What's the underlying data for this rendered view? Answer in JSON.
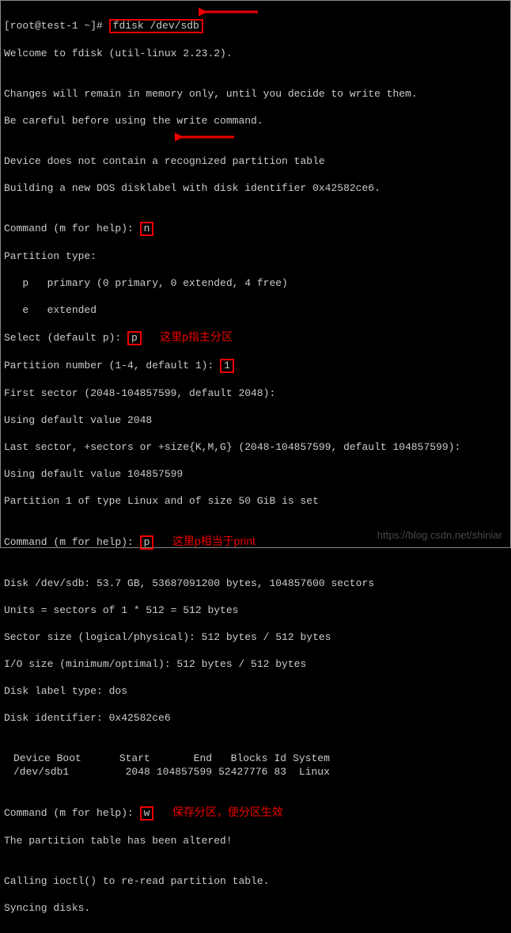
{
  "prompt": {
    "user_host": "[root@test-1 ~]#",
    "command": "fdisk /dev/sdb"
  },
  "lines": {
    "welcome": "Welcome to fdisk (util-linux 2.23.2).",
    "blank": "",
    "changes": "Changes will remain in memory only, until you decide to write them.",
    "careful": "Be careful before using the write command.",
    "noTable": "Device does not contain a recognized partition table",
    "building": "Building a new DOS disklabel with disk identifier 0x42582ce6.",
    "cmdPrompt": "Command (m for help):",
    "n_input": "n",
    "partType": "Partition type:",
    "pPrimary": "   p   primary (0 primary, 0 extended, 4 free)",
    "eExtended": "   e   extended",
    "selectDefault": "Select (default p):",
    "p_input": "p",
    "anno_pPrimary": "这里p指主分区",
    "partNum": "Partition number (1-4, default 1):",
    "one_input": "1",
    "firstSector": "First sector (2048-104857599, default 2048):",
    "usingDefault1": "Using default value 2048",
    "lastSector": "Last sector, +sectors or +size{K,M,G} (2048-104857599, default 104857599):",
    "usingDefault2": "Using default value 104857599",
    "partSet": "Partition 1 of type Linux and of size 50 GiB is set",
    "p_input2": "p",
    "anno_pPrint": "这里p相当于print",
    "diskInfo": "Disk /dev/sdb: 53.7 GB, 53687091200 bytes, 104857600 sectors",
    "units": "Units = sectors of 1 * 512 = 512 bytes",
    "sectorSize": "Sector size (logical/physical): 512 bytes / 512 bytes",
    "ioSize": "I/O size (minimum/optimal): 512 bytes / 512 bytes",
    "labelType": "Disk label type: dos",
    "diskId": "Disk identifier: 0x42582ce6",
    "w_input": "w",
    "anno_wSave": "保存分区，使分区生效",
    "altered": "The partition table has been altered!",
    "ioctl": "Calling ioctl() to re-read partition table.",
    "syncing": "Syncing disks."
  },
  "table": {
    "headers": [
      "Device Boot",
      "Start",
      "End",
      "Blocks",
      "Id",
      "System"
    ],
    "rows": [
      {
        "device": "/dev/sdb1",
        "start": "2048",
        "end": "104857599",
        "blocks": "52427776",
        "id": "83",
        "system": "Linux"
      }
    ]
  },
  "watermark": "https://blog.csdn.net/shiniar"
}
